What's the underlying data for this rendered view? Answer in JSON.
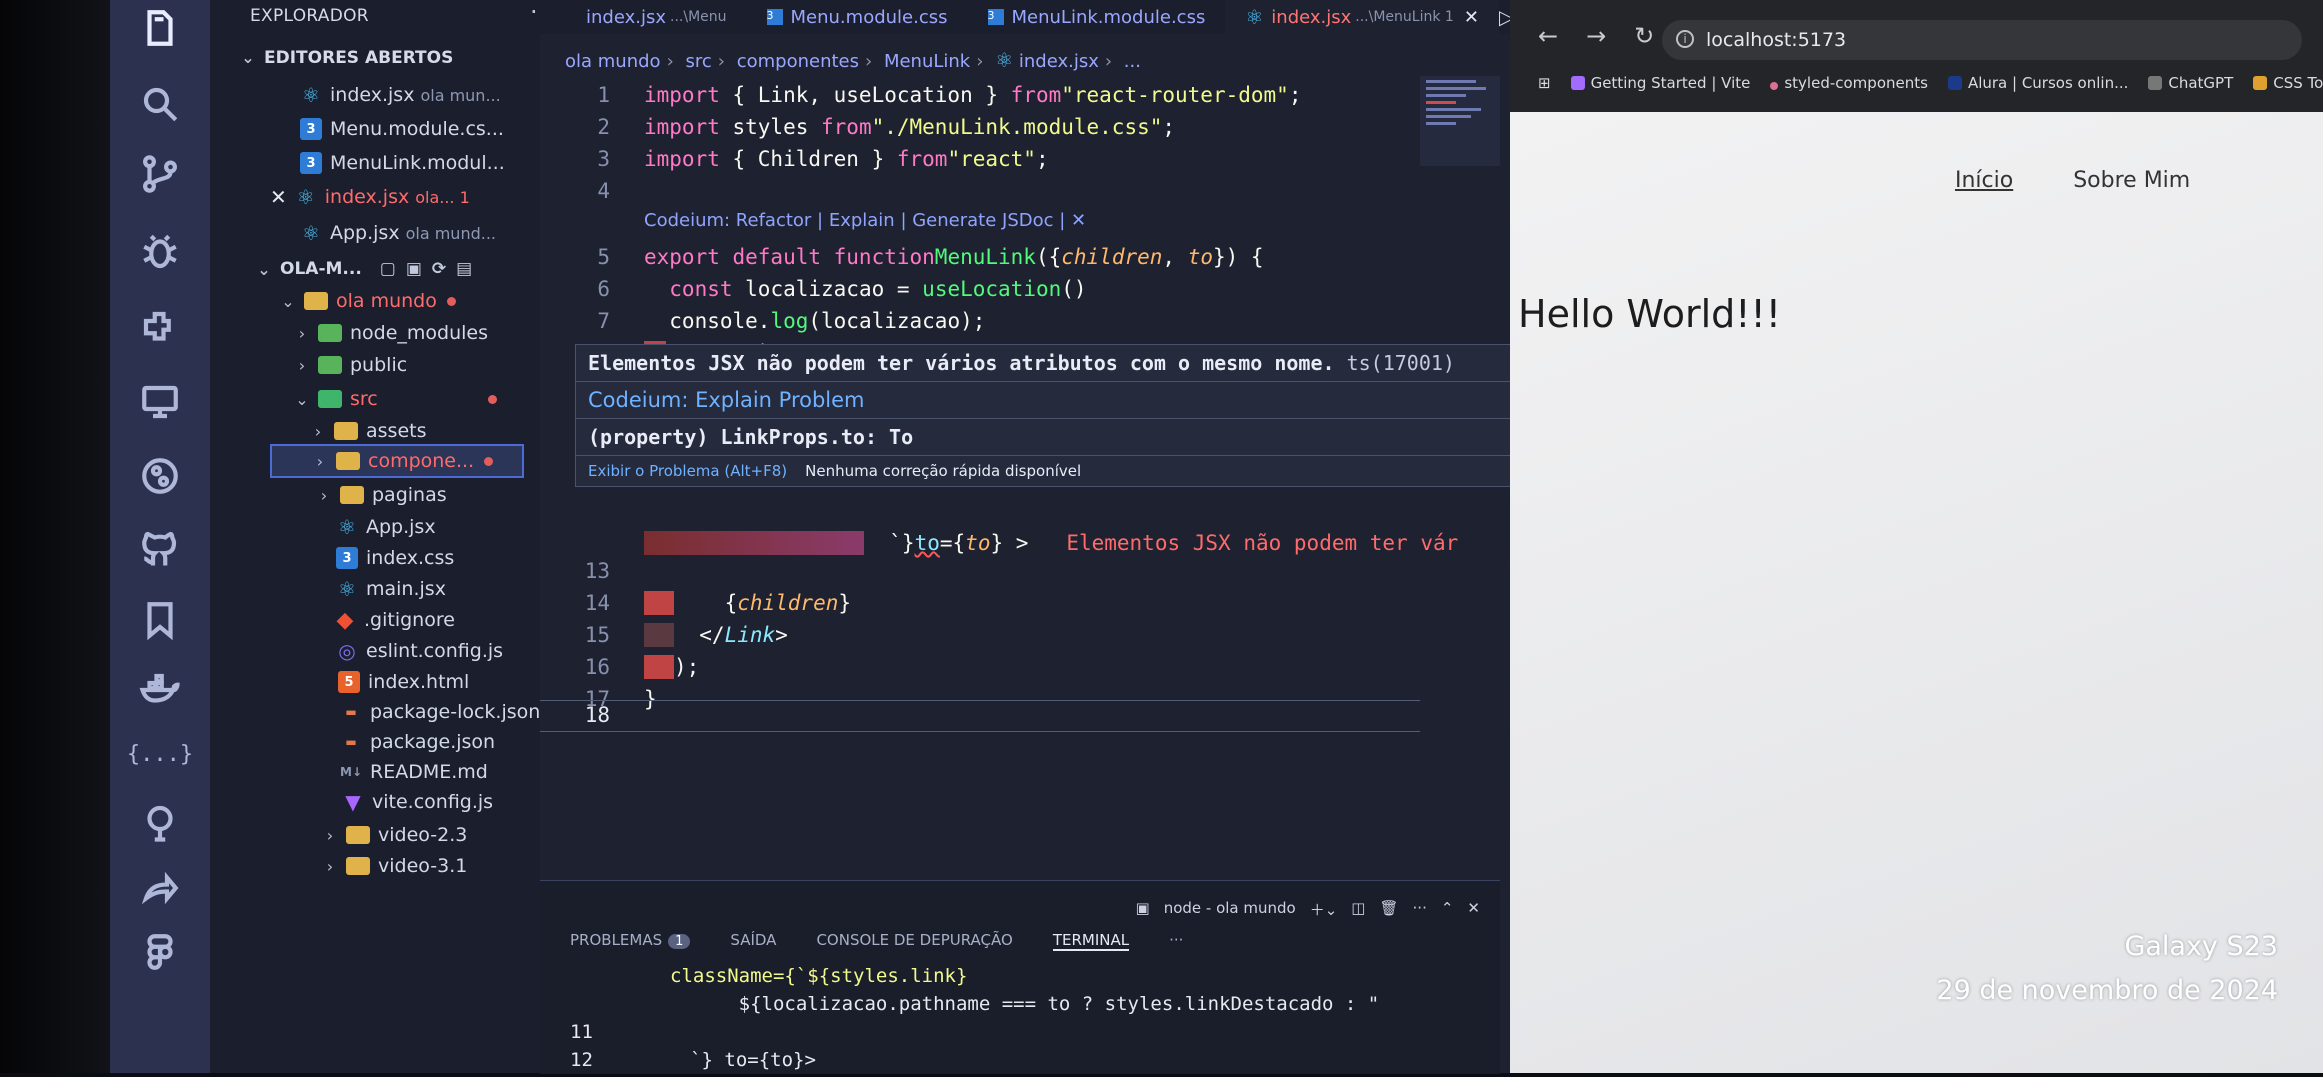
{
  "vscode": {
    "sidebar": {
      "title": "EXPLORADOR",
      "open_editors_title": "EDITORES ABERTOS",
      "open_editors": [
        {
          "name": "index.jsx",
          "hint": "ola mun..."
        },
        {
          "name": "Menu.module.cs...",
          "hint": ""
        },
        {
          "name": "MenuLink.modul...",
          "hint": ""
        },
        {
          "name": "index.jsx",
          "hint": "ola... 1"
        },
        {
          "name": "App.jsx",
          "hint": "ola mund..."
        }
      ],
      "project_title": "OLA-M...",
      "tree": [
        "ola mundo",
        "node_modules",
        "public",
        "src",
        "assets",
        "compone...",
        "paginas",
        "App.jsx",
        "index.css",
        "main.jsx",
        ".gitignore",
        "eslint.config.js",
        "index.html",
        "package-lock.json",
        "package.json",
        "README.md",
        "vite.config.js",
        "video-2.3",
        "video-3.1"
      ]
    },
    "tabs": [
      {
        "label": "index.jsx",
        "sub": "...\\Menu"
      },
      {
        "label": "Menu.module.css",
        "sub": ""
      },
      {
        "label": "MenuLink.module.css",
        "sub": ""
      },
      {
        "label": "index.jsx",
        "sub": "...\\MenuLink 1"
      }
    ],
    "breadcrumb": [
      "ola mundo",
      "src",
      "componentes",
      "MenuLink",
      "index.jsx",
      "..."
    ],
    "codeium_lens": "Codeium: Refactor | Explain | Generate JSDoc | ✕",
    "hover": {
      "error": "Elementos JSX não podem ter vários atributos com o mesmo nome.",
      "code": "ts(17001)",
      "codeium": "Codeium: Explain Problem",
      "property": "(property) LinkProps.to: To",
      "action_view": "Exibir o Problema (Alt+F8)",
      "action_fix": "Nenhuma correção rápida disponível"
    },
    "inline_error": "Elementos JSX não podem ter vár",
    "panel": {
      "tabs": [
        "PROBLEMAS",
        "SAÍDA",
        "CONSOLE DE DEPURAÇÃO",
        "TERMINAL",
        "···"
      ],
      "problems_count": "1",
      "terminal_name": "node - ola mundo",
      "terminal_lines": [
        {
          "n": "",
          "text": "className={`${styles.link}"
        },
        {
          "n": "",
          "text": "      ${localizacao.pathname === to ? styles.linkDestacado : \""
        },
        {
          "n": "11",
          "text": ""
        },
        {
          "n": "12",
          "text": "       `} to={to}>"
        }
      ]
    }
  },
  "browser": {
    "url": "localhost:5173",
    "bookmarks": [
      "Getting Started | Vite",
      "styled-components",
      "Alura | Cursos onlin...",
      "ChatGPT",
      "CSS Tools: Reset CSS"
    ],
    "nav": [
      "Início",
      "Sobre Mim"
    ],
    "heading": "Hello World!!!"
  },
  "watermark": {
    "device": "Galaxy S23",
    "date": "29 de novembro de 2024"
  }
}
